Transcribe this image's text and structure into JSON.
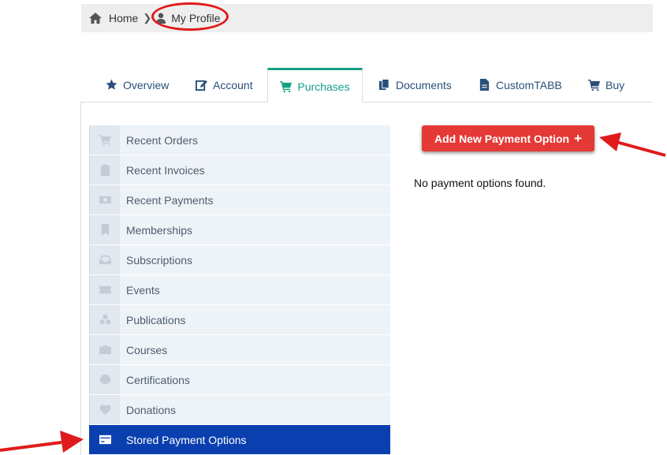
{
  "breadcrumb": {
    "home_label": "Home",
    "separator": "❯",
    "profile_label": "My Profile"
  },
  "tabs": [
    {
      "label": "Overview",
      "icon": "star-icon"
    },
    {
      "label": "Account",
      "icon": "edit-icon"
    },
    {
      "label": "Purchases",
      "icon": "cart-icon",
      "active": true
    },
    {
      "label": "Documents",
      "icon": "documents-icon"
    },
    {
      "label": "CustomTABB",
      "icon": "file-icon"
    },
    {
      "label": "Buy",
      "icon": "cart-icon"
    }
  ],
  "sidebar": {
    "items": [
      {
        "label": "Recent Orders",
        "icon": "cart-icon"
      },
      {
        "label": "Recent Invoices",
        "icon": "clipboard-icon"
      },
      {
        "label": "Recent Payments",
        "icon": "money-icon"
      },
      {
        "label": "Memberships",
        "icon": "bookmark-icon"
      },
      {
        "label": "Subscriptions",
        "icon": "inbox-icon"
      },
      {
        "label": "Events",
        "icon": "ticket-icon"
      },
      {
        "label": "Publications",
        "icon": "cubes-icon"
      },
      {
        "label": "Courses",
        "icon": "briefcase-icon"
      },
      {
        "label": "Certifications",
        "icon": "certificate-icon"
      },
      {
        "label": "Donations",
        "icon": "heart-icon"
      },
      {
        "label": "Stored Payment Options",
        "icon": "credit-card-icon",
        "active": true
      }
    ]
  },
  "main": {
    "add_button_label": "Add New Payment Option",
    "add_button_plus": "+",
    "empty_message": "No payment options found."
  },
  "colors": {
    "accent_teal": "#16a085",
    "sidebar_active": "#0a3fb0",
    "button_red": "#e53935",
    "annotation_red": "#e01b1b"
  }
}
